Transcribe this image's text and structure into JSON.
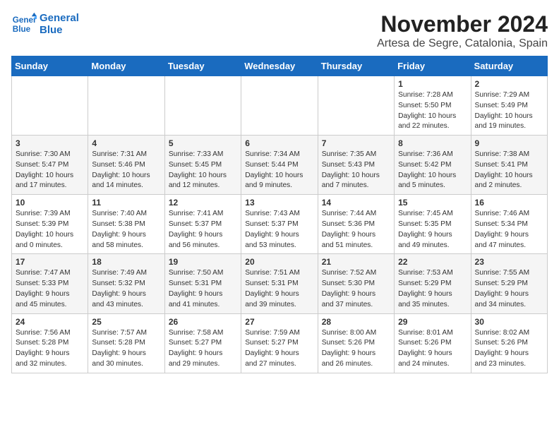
{
  "logo": {
    "line1": "General",
    "line2": "Blue"
  },
  "title": "November 2024",
  "location": "Artesa de Segre, Catalonia, Spain",
  "weekdays": [
    "Sunday",
    "Monday",
    "Tuesday",
    "Wednesday",
    "Thursday",
    "Friday",
    "Saturday"
  ],
  "weeks": [
    [
      {
        "day": "",
        "info": ""
      },
      {
        "day": "",
        "info": ""
      },
      {
        "day": "",
        "info": ""
      },
      {
        "day": "",
        "info": ""
      },
      {
        "day": "",
        "info": ""
      },
      {
        "day": "1",
        "info": "Sunrise: 7:28 AM\nSunset: 5:50 PM\nDaylight: 10 hours\nand 22 minutes."
      },
      {
        "day": "2",
        "info": "Sunrise: 7:29 AM\nSunset: 5:49 PM\nDaylight: 10 hours\nand 19 minutes."
      }
    ],
    [
      {
        "day": "3",
        "info": "Sunrise: 7:30 AM\nSunset: 5:47 PM\nDaylight: 10 hours\nand 17 minutes."
      },
      {
        "day": "4",
        "info": "Sunrise: 7:31 AM\nSunset: 5:46 PM\nDaylight: 10 hours\nand 14 minutes."
      },
      {
        "day": "5",
        "info": "Sunrise: 7:33 AM\nSunset: 5:45 PM\nDaylight: 10 hours\nand 12 minutes."
      },
      {
        "day": "6",
        "info": "Sunrise: 7:34 AM\nSunset: 5:44 PM\nDaylight: 10 hours\nand 9 minutes."
      },
      {
        "day": "7",
        "info": "Sunrise: 7:35 AM\nSunset: 5:43 PM\nDaylight: 10 hours\nand 7 minutes."
      },
      {
        "day": "8",
        "info": "Sunrise: 7:36 AM\nSunset: 5:42 PM\nDaylight: 10 hours\nand 5 minutes."
      },
      {
        "day": "9",
        "info": "Sunrise: 7:38 AM\nSunset: 5:41 PM\nDaylight: 10 hours\nand 2 minutes."
      }
    ],
    [
      {
        "day": "10",
        "info": "Sunrise: 7:39 AM\nSunset: 5:39 PM\nDaylight: 10 hours\nand 0 minutes."
      },
      {
        "day": "11",
        "info": "Sunrise: 7:40 AM\nSunset: 5:38 PM\nDaylight: 9 hours\nand 58 minutes."
      },
      {
        "day": "12",
        "info": "Sunrise: 7:41 AM\nSunset: 5:37 PM\nDaylight: 9 hours\nand 56 minutes."
      },
      {
        "day": "13",
        "info": "Sunrise: 7:43 AM\nSunset: 5:37 PM\nDaylight: 9 hours\nand 53 minutes."
      },
      {
        "day": "14",
        "info": "Sunrise: 7:44 AM\nSunset: 5:36 PM\nDaylight: 9 hours\nand 51 minutes."
      },
      {
        "day": "15",
        "info": "Sunrise: 7:45 AM\nSunset: 5:35 PM\nDaylight: 9 hours\nand 49 minutes."
      },
      {
        "day": "16",
        "info": "Sunrise: 7:46 AM\nSunset: 5:34 PM\nDaylight: 9 hours\nand 47 minutes."
      }
    ],
    [
      {
        "day": "17",
        "info": "Sunrise: 7:47 AM\nSunset: 5:33 PM\nDaylight: 9 hours\nand 45 minutes."
      },
      {
        "day": "18",
        "info": "Sunrise: 7:49 AM\nSunset: 5:32 PM\nDaylight: 9 hours\nand 43 minutes."
      },
      {
        "day": "19",
        "info": "Sunrise: 7:50 AM\nSunset: 5:31 PM\nDaylight: 9 hours\nand 41 minutes."
      },
      {
        "day": "20",
        "info": "Sunrise: 7:51 AM\nSunset: 5:31 PM\nDaylight: 9 hours\nand 39 minutes."
      },
      {
        "day": "21",
        "info": "Sunrise: 7:52 AM\nSunset: 5:30 PM\nDaylight: 9 hours\nand 37 minutes."
      },
      {
        "day": "22",
        "info": "Sunrise: 7:53 AM\nSunset: 5:29 PM\nDaylight: 9 hours\nand 35 minutes."
      },
      {
        "day": "23",
        "info": "Sunrise: 7:55 AM\nSunset: 5:29 PM\nDaylight: 9 hours\nand 34 minutes."
      }
    ],
    [
      {
        "day": "24",
        "info": "Sunrise: 7:56 AM\nSunset: 5:28 PM\nDaylight: 9 hours\nand 32 minutes."
      },
      {
        "day": "25",
        "info": "Sunrise: 7:57 AM\nSunset: 5:28 PM\nDaylight: 9 hours\nand 30 minutes."
      },
      {
        "day": "26",
        "info": "Sunrise: 7:58 AM\nSunset: 5:27 PM\nDaylight: 9 hours\nand 29 minutes."
      },
      {
        "day": "27",
        "info": "Sunrise: 7:59 AM\nSunset: 5:27 PM\nDaylight: 9 hours\nand 27 minutes."
      },
      {
        "day": "28",
        "info": "Sunrise: 8:00 AM\nSunset: 5:26 PM\nDaylight: 9 hours\nand 26 minutes."
      },
      {
        "day": "29",
        "info": "Sunrise: 8:01 AM\nSunset: 5:26 PM\nDaylight: 9 hours\nand 24 minutes."
      },
      {
        "day": "30",
        "info": "Sunrise: 8:02 AM\nSunset: 5:26 PM\nDaylight: 9 hours\nand 23 minutes."
      }
    ]
  ]
}
